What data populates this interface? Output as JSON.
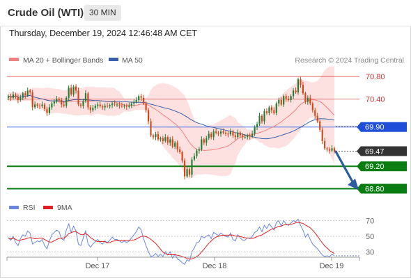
{
  "header": {
    "instrument": "Crude Oil (WTI)",
    "timeframe": "30 MIN",
    "datetime": "Thursday, December 19, 2024 12:46:48 AM CET"
  },
  "legend": {
    "ma20_label": "MA 20 + Bollinger Bands",
    "ma50_label": "MA 50",
    "credit": "Research © 2024 Trading Central",
    "rsi_label": "RSI",
    "ma9_label": "9MA"
  },
  "colors": {
    "bull": "#1e7d32",
    "bear": "#d84315",
    "bb_fill": "#fde0e0",
    "ma20": "#f08080",
    "ma50": "#3a5fa8",
    "resistance": "#d32f2f",
    "pivot": "#1f4fd8",
    "support": "#0a7d12",
    "last": "#333333",
    "arrow": "#2a5d9f",
    "rsi": "#6a86e0",
    "rsi_ma": "#e02020"
  },
  "chart_data": [
    {
      "type": "candlestick",
      "x_labels": [
        "Dec 17",
        "Dec 18",
        "Dec 19"
      ],
      "ylim": [
        68.72,
        70.9
      ],
      "levels": [
        {
          "label": "70.80",
          "value": 70.8,
          "kind": "resistance"
        },
        {
          "label": "70.40",
          "value": 70.4,
          "kind": "resistance"
        },
        {
          "label": "69.90",
          "value": 69.9,
          "kind": "pivot"
        },
        {
          "label": "69.47",
          "value": 69.47,
          "kind": "last"
        },
        {
          "label": "69.20",
          "value": 69.2,
          "kind": "support"
        },
        {
          "label": "68.80",
          "value": 68.8,
          "kind": "support"
        }
      ],
      "close": [
        70.45,
        70.42,
        70.48,
        70.44,
        70.38,
        70.42,
        70.5,
        70.46,
        70.55,
        70.52,
        70.25,
        70.3,
        70.28,
        70.27,
        70.3,
        70.22,
        70.15,
        70.25,
        70.32,
        70.35,
        70.4,
        70.38,
        70.3,
        70.28,
        70.42,
        70.6,
        70.48,
        70.62,
        70.55,
        70.3,
        70.28,
        70.36,
        70.5,
        70.25,
        70.2,
        70.24,
        70.28,
        70.3,
        70.27,
        70.25,
        70.28,
        70.27,
        70.29,
        70.32,
        70.3,
        70.3,
        70.28,
        70.27,
        70.28,
        70.26,
        70.28,
        70.32,
        70.35,
        70.38,
        70.45,
        70.42,
        70.32,
        70.2,
        70.0,
        69.75,
        69.72,
        69.77,
        69.68,
        69.7,
        69.65,
        69.72,
        69.62,
        69.68,
        69.55,
        69.62,
        69.5,
        69.45,
        69.3,
        69.02,
        69.15,
        69.05,
        69.32,
        69.38,
        69.48,
        69.5,
        69.68,
        69.62,
        69.7,
        69.78,
        69.72,
        69.82,
        69.8,
        69.78,
        69.82,
        69.8,
        69.78,
        69.77,
        69.82,
        69.75,
        69.72,
        69.8,
        69.75,
        69.72,
        69.72,
        69.75,
        69.73,
        69.78,
        69.9,
        69.95,
        70.1,
        70.0,
        70.18,
        70.15,
        70.25,
        70.2,
        70.15,
        70.32,
        70.38,
        70.3,
        70.45,
        70.4,
        70.38,
        70.45,
        70.55,
        70.52,
        70.75,
        70.65,
        70.5,
        70.35,
        70.42,
        70.32,
        70.2,
        70.1,
        70.0,
        69.85,
        69.65,
        69.52,
        69.5,
        69.48,
        69.52,
        69.47
      ],
      "rsi": [
        48,
        45,
        50,
        42,
        38,
        47,
        52,
        50,
        57,
        54,
        40,
        42,
        44,
        43,
        46,
        38,
        34,
        44,
        52,
        55,
        58,
        56,
        47,
        45,
        58,
        66,
        55,
        63,
        57,
        40,
        38,
        48,
        57,
        40,
        36,
        40,
        43,
        46,
        42,
        40,
        44,
        42,
        45,
        49,
        46,
        46,
        44,
        42,
        44,
        42,
        44,
        48,
        52,
        56,
        62,
        58,
        47,
        38,
        30,
        24,
        25,
        28,
        24,
        27,
        24,
        30,
        26,
        30,
        22,
        27,
        21,
        19,
        16,
        14,
        20,
        18,
        30,
        35,
        42,
        43,
        50,
        48,
        50,
        52,
        47,
        55,
        53,
        51,
        54,
        52,
        50,
        49,
        54,
        46,
        44,
        52,
        48,
        45,
        45,
        48,
        47,
        50,
        55,
        57,
        62,
        56,
        64,
        60,
        66,
        62,
        58,
        68,
        70,
        63,
        70,
        66,
        64,
        67,
        70,
        69,
        72,
        64,
        58,
        49,
        53,
        46,
        40,
        37,
        34,
        30,
        26,
        24,
        25,
        24,
        27,
        25
      ]
    },
    {
      "type": "line",
      "name": "RSI",
      "y_ticks": [
        30,
        50,
        70
      ],
      "ylim": [
        25,
        75
      ]
    }
  ]
}
